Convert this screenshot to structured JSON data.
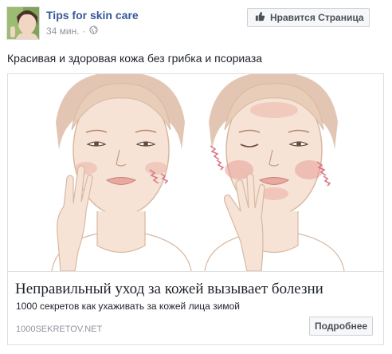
{
  "header": {
    "page_name": "Tips for skin care",
    "time": "34 мин.",
    "privacy_icon": "globe-icon",
    "like_button_label": "Нравится Страница",
    "like_icon": "thumbs-up-icon"
  },
  "post": {
    "text": "Красивая и здоровая кожа без грибка и псориаза"
  },
  "card": {
    "title": "Неправильный уход за кожей вызывает болезни",
    "description": "1000 секретов как ухаживать за кожей лица зимой",
    "domain": "1000SEKRETOV.NET",
    "button_label": "Подробнее"
  },
  "colors": {
    "link": "#365899",
    "muted": "#90949c",
    "text": "#1d2129",
    "border": "#dddfe2",
    "button_bg": "#f6f7f9",
    "skin": "#f6e3d6",
    "hair": "#d9b8a0",
    "irritation": "#d97a8a"
  }
}
